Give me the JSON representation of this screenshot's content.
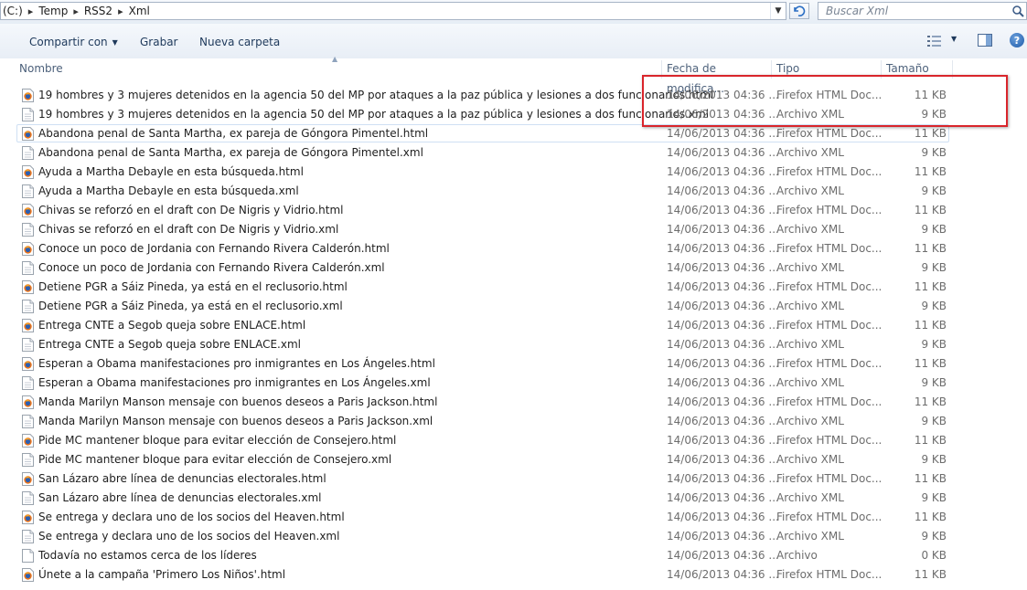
{
  "address": {
    "crumbs": [
      "(C:)",
      "Temp",
      "RSS2",
      "Xml"
    ],
    "separator": "▸",
    "search_placeholder": "Buscar Xml"
  },
  "toolbar": {
    "share_label": "Compartir con",
    "burn_label": "Grabar",
    "new_folder_label": "Nueva carpeta"
  },
  "columns": {
    "name": "Nombre",
    "date": "Fecha de modifica...",
    "type": "Tipo",
    "size": "Tamaño"
  },
  "files": [
    {
      "name": "19 hombres y 3 mujeres detenidos en la agencia 50 del MP por ataques a la paz pública y lesiones a dos funcionarios.html",
      "date": "14/06/2013 04:36 ...",
      "type": "Firefox HTML Doc...",
      "size": "11 KB",
      "icon": "firefox-html-icon"
    },
    {
      "name": "19 hombres y 3 mujeres detenidos en la agencia 50 del MP por ataques a la paz pública y lesiones a dos funcionarios.xml",
      "date": "14/06/2013 04:36 ...",
      "type": "Archivo XML",
      "size": "9 KB",
      "icon": "xml-file-icon"
    },
    {
      "name": "Abandona penal de Santa Martha, ex pareja de Góngora Pimentel.html",
      "date": "14/06/2013 04:36 ...",
      "type": "Firefox HTML Doc...",
      "size": "11 KB",
      "icon": "firefox-html-icon"
    },
    {
      "name": "Abandona penal de Santa Martha, ex pareja de Góngora Pimentel.xml",
      "date": "14/06/2013 04:36 ...",
      "type": "Archivo XML",
      "size": "9 KB",
      "icon": "xml-file-icon"
    },
    {
      "name": "Ayuda a Martha Debayle en esta búsqueda.html",
      "date": "14/06/2013 04:36 ...",
      "type": "Firefox HTML Doc...",
      "size": "11 KB",
      "icon": "firefox-html-icon"
    },
    {
      "name": "Ayuda a Martha Debayle en esta búsqueda.xml",
      "date": "14/06/2013 04:36 ...",
      "type": "Archivo XML",
      "size": "9 KB",
      "icon": "xml-file-icon"
    },
    {
      "name": "Chivas se reforzó en el draft con De Nigris y Vidrio.html",
      "date": "14/06/2013 04:36 ...",
      "type": "Firefox HTML Doc...",
      "size": "11 KB",
      "icon": "firefox-html-icon"
    },
    {
      "name": "Chivas se reforzó en el draft con De Nigris y Vidrio.xml",
      "date": "14/06/2013 04:36 ...",
      "type": "Archivo XML",
      "size": "9 KB",
      "icon": "xml-file-icon"
    },
    {
      "name": "Conoce un poco de Jordania con Fernando Rivera Calderón.html",
      "date": "14/06/2013 04:36 ...",
      "type": "Firefox HTML Doc...",
      "size": "11 KB",
      "icon": "firefox-html-icon"
    },
    {
      "name": "Conoce un poco de Jordania con Fernando Rivera Calderón.xml",
      "date": "14/06/2013 04:36 ...",
      "type": "Archivo XML",
      "size": "9 KB",
      "icon": "xml-file-icon"
    },
    {
      "name": "Detiene PGR a Sáiz Pineda, ya está en el reclusorio.html",
      "date": "14/06/2013 04:36 ...",
      "type": "Firefox HTML Doc...",
      "size": "11 KB",
      "icon": "firefox-html-icon"
    },
    {
      "name": "Detiene PGR a Sáiz Pineda, ya está en el reclusorio.xml",
      "date": "14/06/2013 04:36 ...",
      "type": "Archivo XML",
      "size": "9 KB",
      "icon": "xml-file-icon"
    },
    {
      "name": "Entrega CNTE a Segob queja sobre ENLACE.html",
      "date": "14/06/2013 04:36 ...",
      "type": "Firefox HTML Doc...",
      "size": "11 KB",
      "icon": "firefox-html-icon"
    },
    {
      "name": "Entrega CNTE a Segob queja sobre ENLACE.xml",
      "date": "14/06/2013 04:36 ...",
      "type": "Archivo XML",
      "size": "9 KB",
      "icon": "xml-file-icon"
    },
    {
      "name": "Esperan a Obama manifestaciones pro inmigrantes en Los Ángeles.html",
      "date": "14/06/2013 04:36 ...",
      "type": "Firefox HTML Doc...",
      "size": "11 KB",
      "icon": "firefox-html-icon"
    },
    {
      "name": "Esperan a Obama manifestaciones pro inmigrantes en Los Ángeles.xml",
      "date": "14/06/2013 04:36 ...",
      "type": "Archivo XML",
      "size": "9 KB",
      "icon": "xml-file-icon"
    },
    {
      "name": "Manda Marilyn Manson mensaje con buenos deseos a Paris Jackson.html",
      "date": "14/06/2013 04:36 ...",
      "type": "Firefox HTML Doc...",
      "size": "11 KB",
      "icon": "firefox-html-icon"
    },
    {
      "name": "Manda Marilyn Manson mensaje con buenos deseos a Paris Jackson.xml",
      "date": "14/06/2013 04:36 ...",
      "type": "Archivo XML",
      "size": "9 KB",
      "icon": "xml-file-icon"
    },
    {
      "name": "Pide MC mantener bloque para evitar elección de Consejero.html",
      "date": "14/06/2013 04:36 ...",
      "type": "Firefox HTML Doc...",
      "size": "11 KB",
      "icon": "firefox-html-icon"
    },
    {
      "name": "Pide MC mantener bloque para evitar elección de Consejero.xml",
      "date": "14/06/2013 04:36 ...",
      "type": "Archivo XML",
      "size": "9 KB",
      "icon": "xml-file-icon"
    },
    {
      "name": "San Lázaro abre línea de denuncias electorales.html",
      "date": "14/06/2013 04:36 ...",
      "type": "Firefox HTML Doc...",
      "size": "11 KB",
      "icon": "firefox-html-icon"
    },
    {
      "name": "San Lázaro abre línea de denuncias electorales.xml",
      "date": "14/06/2013 04:36 ...",
      "type": "Archivo XML",
      "size": "9 KB",
      "icon": "xml-file-icon"
    },
    {
      "name": "Se entrega y declara uno de los socios del Heaven.html",
      "date": "14/06/2013 04:36 ...",
      "type": "Firefox HTML Doc...",
      "size": "11 KB",
      "icon": "firefox-html-icon"
    },
    {
      "name": "Se entrega y declara uno de los socios del Heaven.xml",
      "date": "14/06/2013 04:36 ...",
      "type": "Archivo XML",
      "size": "9 KB",
      "icon": "xml-file-icon"
    },
    {
      "name": "Todavía no estamos cerca de los líderes",
      "date": "14/06/2013 04:36 ...",
      "type": "Archivo",
      "size": "0 KB",
      "icon": "blank-file-icon"
    },
    {
      "name": "Únete a la campaña 'Primero Los Niños'.html",
      "date": "14/06/2013 04:36 ...",
      "type": "Firefox HTML Doc...",
      "size": "11 KB",
      "icon": "firefox-html-icon"
    }
  ],
  "selected_index": 2,
  "colors": {
    "highlight": "#d9252b",
    "header_text": "#4c607a",
    "toolbar_text": "#1e395b"
  }
}
